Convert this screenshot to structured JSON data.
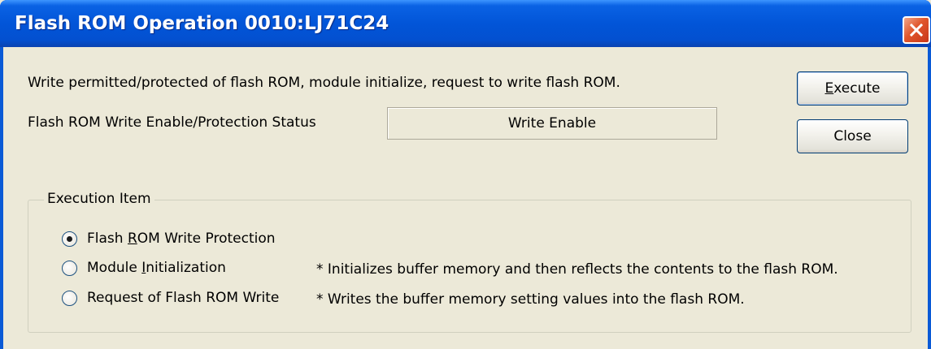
{
  "window": {
    "title": "Flash ROM Operation 0010:LJ71C24"
  },
  "description": "Write permitted/protected of flash ROM, module initialize, request to write flash ROM.",
  "status": {
    "label": "Flash ROM Write Enable/Protection Status",
    "value": "Write Enable"
  },
  "buttons": {
    "execute": {
      "pre": "",
      "mnemonic": "E",
      "post": "xecute"
    },
    "close": "Close"
  },
  "execution_item": {
    "legend": "Execution Item",
    "options": [
      {
        "pre": "Flash ",
        "mnemonic": "R",
        "post": "OM Write Protection",
        "selected": true,
        "note": ""
      },
      {
        "pre": "Module ",
        "mnemonic": "I",
        "post": "nitialization",
        "selected": false,
        "note": "* Initializes buffer memory and then reflects the contents to the flash ROM."
      },
      {
        "pre": "Request of Flash ROM Write",
        "mnemonic": "",
        "post": "",
        "selected": false,
        "note": "* Writes the buffer memory setting values into the flash ROM."
      }
    ]
  },
  "icons": {
    "close": "close-icon"
  },
  "colors": {
    "titlebar": "#0255d8",
    "close_button": "#e0562c",
    "dialog_background": "#ece9d8"
  }
}
